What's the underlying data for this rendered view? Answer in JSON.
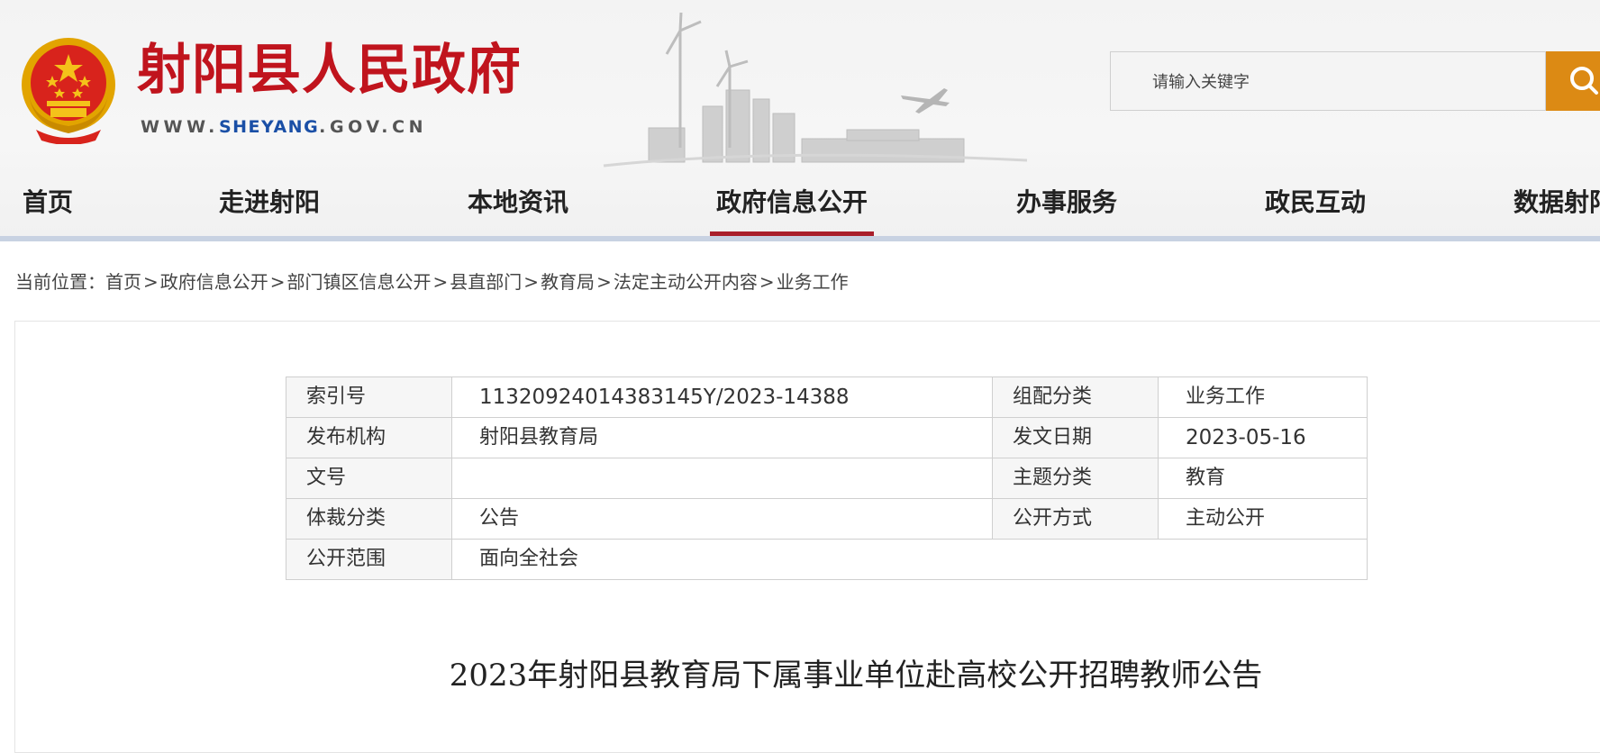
{
  "header": {
    "site_name": "射阳县人民政府",
    "site_url_prefix": "WWW.",
    "site_url_highlight": "SHEYANG",
    "site_url_suffix": ".GOV.CN",
    "brand_red": "#c0141d",
    "url_blue": "#1a4fa6"
  },
  "search": {
    "placeholder": "请输入关键字",
    "button_icon": "search-icon",
    "button_color": "#dc8a14"
  },
  "nav": {
    "items": [
      {
        "label": "首页"
      },
      {
        "label": "走进射阳"
      },
      {
        "label": "本地资讯"
      },
      {
        "label": "政府信息公开",
        "active": true
      },
      {
        "label": "办事服务"
      },
      {
        "label": "政民互动"
      },
      {
        "label": "数据射阳"
      }
    ],
    "active_color": "#a91f2b"
  },
  "breadcrumb": {
    "prefix": "当前位置：",
    "separator": ">",
    "items": [
      "首页",
      "政府信息公开",
      "部门镇区信息公开",
      "县直部门",
      "教育局",
      "法定主动公开内容",
      "业务工作"
    ]
  },
  "meta_table": {
    "index_label": "索引号",
    "index_value": "11320924014383145Y/2023-14388",
    "category_label": "组配分类",
    "category_value": "业务工作",
    "publisher_label": "发布机构",
    "publisher_value": "射阳县教育局",
    "date_label": "发文日期",
    "date_value": "2023-05-16",
    "doc_no_label": "文号",
    "doc_no_value": "",
    "topic_label": "主题分类",
    "topic_value": "教育",
    "genre_label": "体裁分类",
    "genre_value": "公告",
    "method_label": "公开方式",
    "method_value": "主动公开",
    "scope_label": "公开范围",
    "scope_value": "面向全社会"
  },
  "article": {
    "title": "2023年射阳县教育局下属事业单位赴高校公开招聘教师公告"
  }
}
